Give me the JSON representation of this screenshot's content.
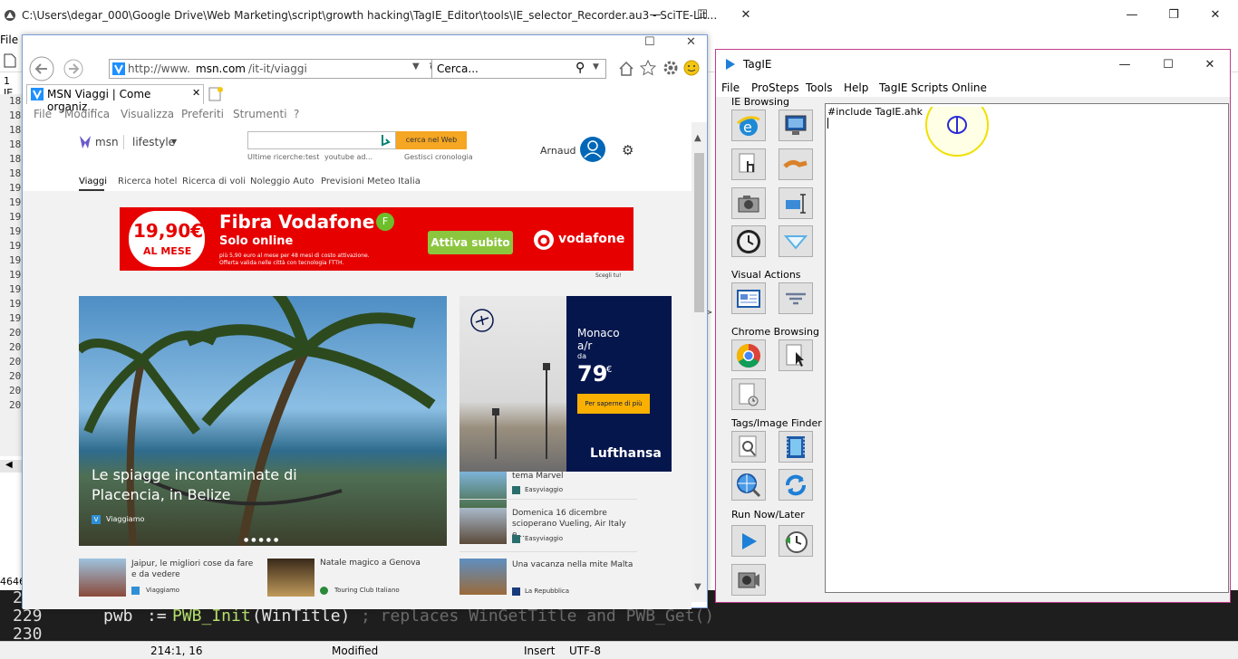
{
  "scite": {
    "title": "C:\\Users\\degar_000\\Google Drive\\Web Marketing\\script\\growth hacking\\TagIE_Editor\\tools\\IE_selector_Recorder.au3 - SciTE-Lit...",
    "menu_file": "File",
    "tab_label": "1 IE_",
    "gutter": [
      "18",
      "18",
      "18",
      "18",
      "18",
      "18",
      "19",
      "19",
      "19",
      "19",
      "19",
      "19",
      "19",
      "19",
      "19",
      "19",
      "20",
      "20",
      "20",
      "20",
      "20",
      "20"
    ],
    "mid_number": "4646",
    "code_line1_num": "2",
    "code_line2_num": "229",
    "code_line3_num": "230",
    "code_line2": {
      "var": "pwb",
      "op": ":=",
      "func": "PWB_Init",
      "arg": "(WinTitle)",
      "comment": "; replaces WinGetTitle and PWB_Get()"
    },
    "status": {
      "pos": "214:1, 16",
      "mode": "Modified",
      "ins": "Insert",
      "enc": "UTF-8"
    }
  },
  "ie": {
    "url_prefix": "http://www.",
    "url_domain": "msn.com",
    "url_path": "/it-it/viaggi",
    "search_placeholder": "Cerca...",
    "tab_title": "MSN Viaggi | Come organiz...",
    "menu": [
      "File",
      "Modifica",
      "Visualizza",
      "Preferiti",
      "Strumenti",
      "?"
    ]
  },
  "msn": {
    "logo": "msn",
    "section": "lifestyle",
    "search_button": "cerca nel Web",
    "recent_label": "Ultime ricerche:",
    "recent1": "test",
    "recent2": "youtube ad...",
    "history": "Gestisci cronologia",
    "user": "Arnaud",
    "nav": [
      "Viaggi",
      "Ricerca hotel",
      "Ricerca di voli",
      "Noleggio Auto",
      "Previsioni Meteo Italia"
    ],
    "ad": {
      "price": "19,90€",
      "price_sub": "AL MESE",
      "title": "Fibra Vodafone",
      "subtitle": "Solo online",
      "fine1": "più 5,90 euro al mese per 48 mesi di costo attivazione.",
      "fine2": "Offerta valida nelle città con tecnologia FTTH.",
      "cta": "Attiva subito",
      "brand": "vodafone",
      "adchoices": "Scegli tu!"
    },
    "hero": {
      "title_line1": "Le spiagge incontaminate di",
      "title_line2": "Placencia, in Belize",
      "source": "Viaggiamo"
    },
    "lufthansa": {
      "l1": "Monaco",
      "l2": "a/r",
      "l3": "da",
      "price": "79",
      "currency": "€",
      "cta": "Per saperne di più",
      "brand": "Lufthansa"
    },
    "side_items": [
      {
        "title": "tema Marvel",
        "source": "Easyviaggio"
      },
      {
        "title": "Domenica 16 dicembre scioperano Vueling, Air Italy e...",
        "source": "Easyviaggio"
      },
      {
        "title": "Una vacanza nella mite Malta",
        "source": "La Repubblica"
      }
    ],
    "bottom_items": [
      {
        "title": "Jaipur, le migliori cose da fare e da vedere",
        "source": "Viaggiamo"
      },
      {
        "title": "Natale magico a Genova",
        "source": "Touring Club Italiano"
      }
    ]
  },
  "tagie": {
    "title": "TagIE",
    "menu": [
      "File",
      "ProSteps",
      "Tools",
      "Help",
      "TagIE Scripts Online"
    ],
    "groups": [
      "IE Browsing",
      "Visual Actions",
      "Chrome Browsing",
      "Tags/Image Finder",
      "Run Now/Later"
    ],
    "editor_text": "#include TagIE.ahk"
  }
}
